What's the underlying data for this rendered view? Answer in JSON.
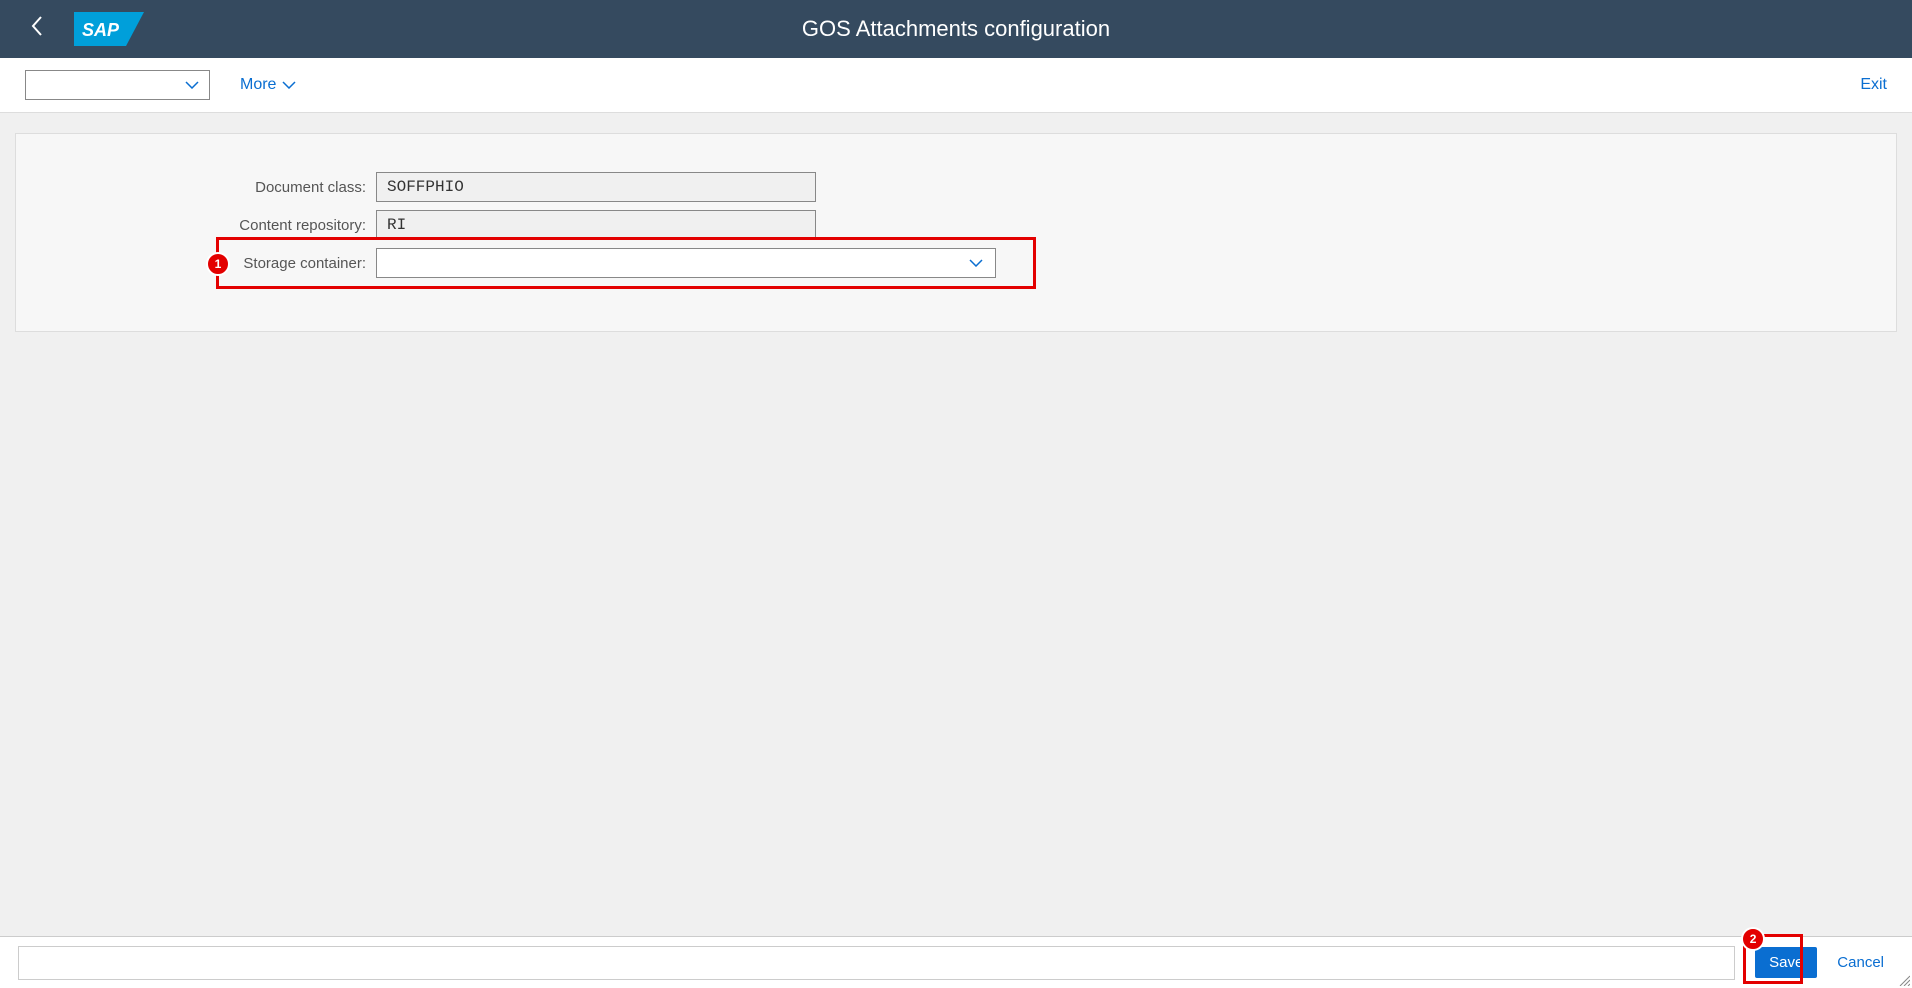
{
  "header": {
    "title": "GOS Attachments configuration"
  },
  "toolbar": {
    "more_label": "More",
    "exit_label": "Exit"
  },
  "form": {
    "document_class": {
      "label": "Document class:",
      "value": "SOFFPHIO"
    },
    "content_repository": {
      "label": "Content repository:",
      "value": "RI"
    },
    "storage_container": {
      "label": "Storage container:",
      "value": ""
    }
  },
  "annotations": {
    "step1": "1",
    "step2": "2"
  },
  "footer": {
    "save_label": "Save",
    "cancel_label": "Cancel"
  }
}
